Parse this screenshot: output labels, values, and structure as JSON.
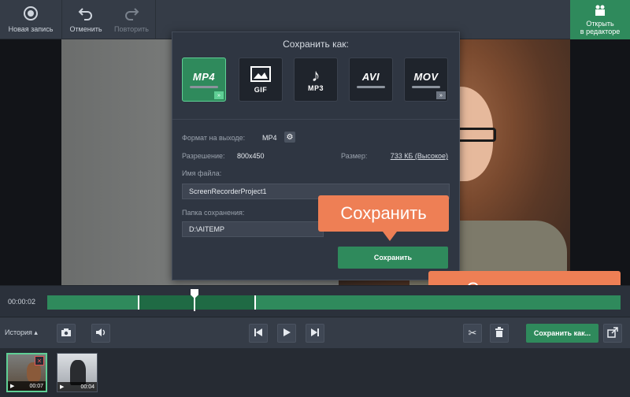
{
  "toolbar": {
    "new_recording": "Новая запись",
    "undo": "Отменить",
    "redo": "Повторить",
    "open_editor_line1": "Открыть",
    "open_editor_line2": "в редакторе"
  },
  "dialog": {
    "title": "Сохранить как:",
    "formats": [
      {
        "label": "MP4",
        "selected": true
      },
      {
        "label": "GIF",
        "selected": false
      },
      {
        "label": "MP3",
        "selected": false
      },
      {
        "label": "AVI",
        "selected": false
      },
      {
        "label": "MOV",
        "selected": false
      }
    ],
    "output_format_label": "Формат на выходе:",
    "output_format_value": "MP4",
    "resolution_label": "Разрешение:",
    "resolution_value": "800x450",
    "size_label": "Размер:",
    "size_value": "733 КБ (Высокое)",
    "filename_label": "Имя файла:",
    "filename_value": "ScreenRecorderProject1",
    "folder_label": "Папка сохранения:",
    "folder_value": "D:\\AITEMP",
    "save_button": "Сохранить"
  },
  "callouts": {
    "save": "Сохранить",
    "save_as": "Сохранить как"
  },
  "timeline": {
    "time": "00:00:02"
  },
  "controls": {
    "history": "История ▴",
    "save_as_button": "Сохранить как..."
  },
  "clips": [
    {
      "duration": "00:07",
      "selected": true
    },
    {
      "duration": "00:04",
      "selected": false
    }
  ],
  "colors": {
    "accent_green": "#2f8a5c",
    "callout_orange": "#ee7f55",
    "panel": "#353c47"
  }
}
